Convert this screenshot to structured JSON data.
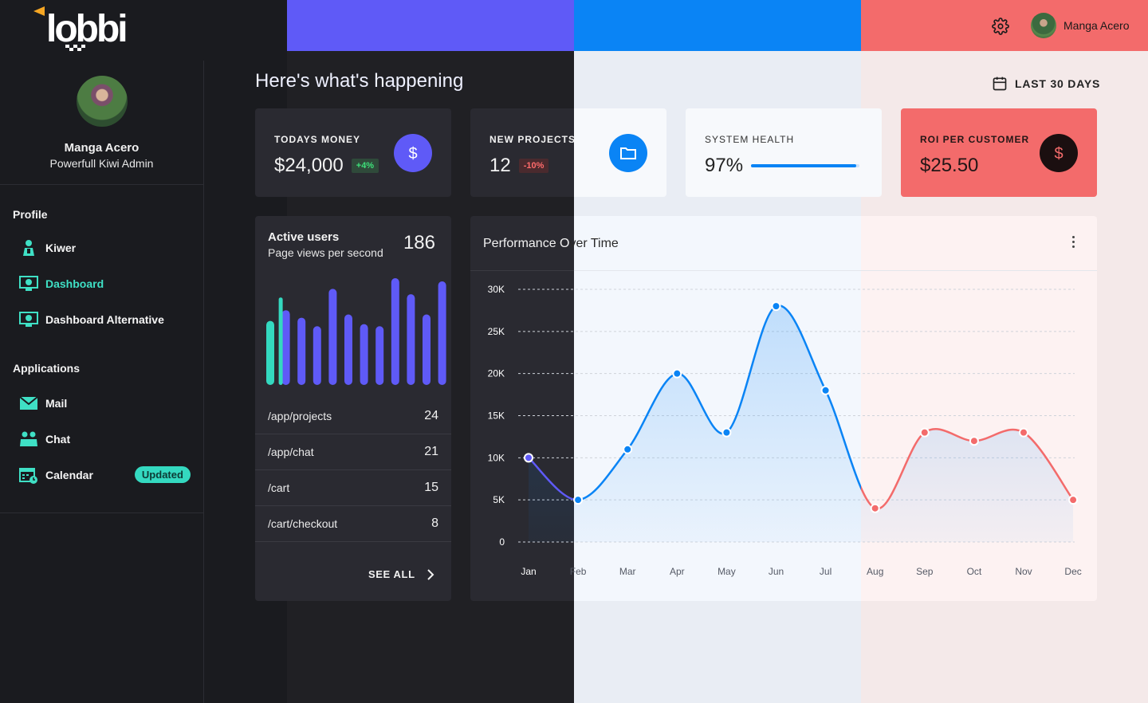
{
  "header": {
    "logo_text": "lobbi",
    "user_name": "Manga Acero"
  },
  "sidebar": {
    "user_name": "Manga Acero",
    "user_role": "Powerfull Kiwi Admin",
    "sections": [
      {
        "title": "Profile",
        "items": [
          {
            "label": "Kiwer",
            "icon": "user-icon"
          },
          {
            "label": "Dashboard",
            "icon": "dashboard-icon",
            "active": true
          },
          {
            "label": "Dashboard Alternative",
            "icon": "dashboard-icon"
          }
        ]
      },
      {
        "title": "Applications",
        "items": [
          {
            "label": "Mail",
            "icon": "mail-icon"
          },
          {
            "label": "Chat",
            "icon": "chat-icon"
          },
          {
            "label": "Calendar",
            "icon": "calendar-icon",
            "badge": "Updated"
          }
        ]
      }
    ]
  },
  "main": {
    "title": "Here's what's happening",
    "date_range": "LAST 30 DAYS",
    "stats": [
      {
        "label": "TODAYS MONEY",
        "value": "$24,000",
        "change": "+4%",
        "icon": "dollar-icon"
      },
      {
        "label": "NEW PROJECTS",
        "value": "12",
        "change": "-10%",
        "icon": "folder-icon"
      },
      {
        "label": "SYSTEM HEALTH",
        "value": "97%",
        "progress": 0.97
      },
      {
        "label": "ROI PER CUSTOMER",
        "value": "$25.50",
        "icon": "dollar-icon"
      }
    ],
    "active_users": {
      "title": "Active users",
      "subtitle": "Page views per second",
      "count": "186",
      "bars": [
        0.6,
        0.7,
        0.63,
        0.55,
        0.9,
        0.66,
        0.57,
        0.55,
        1.0,
        0.85,
        0.66,
        0.97
      ],
      "routes": [
        {
          "path": "/app/projects",
          "views": "24"
        },
        {
          "path": "/app/chat",
          "views": "21"
        },
        {
          "path": "/cart",
          "views": "15"
        },
        {
          "path": "/cart/checkout",
          "views": "8"
        }
      ],
      "see_all": "SEE ALL"
    },
    "performance": {
      "title_part1": "Performance O",
      "title_part2": "ver Time"
    }
  },
  "chart_data": {
    "type": "area",
    "categories": [
      "Jan",
      "Feb",
      "Mar",
      "Apr",
      "May",
      "Jun",
      "Jul",
      "Aug",
      "Sep",
      "Oct",
      "Nov",
      "Dec"
    ],
    "values": [
      10000,
      5000,
      11000,
      20000,
      13000,
      28000,
      18000,
      4000,
      13000,
      12000,
      13000,
      5000
    ],
    "ylim": [
      0,
      30000
    ],
    "y_ticks": [
      "0",
      "5K",
      "10K",
      "15K",
      "20K",
      "25K",
      "30K"
    ],
    "grid": true,
    "colors": {
      "purple": "#5f5af7",
      "blue": "#0a84f5",
      "red": "#f36b6b"
    }
  }
}
